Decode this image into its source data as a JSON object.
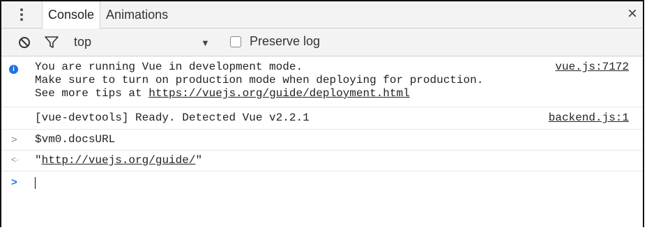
{
  "tabbar": {
    "menu_icon": "kebab-menu-icon",
    "tabs": [
      {
        "label": "Console",
        "active": true
      },
      {
        "label": "Animations",
        "active": false
      }
    ],
    "close_icon": "close-icon",
    "close_glyph": "×"
  },
  "toolbar": {
    "clear_icon": "clear-console-icon",
    "filter_icon": "filter-icon",
    "context_label": "top",
    "dropdown_glyph": "▼",
    "preserve_log_label": "Preserve log",
    "preserve_log_checked": false
  },
  "console": {
    "messages": [
      {
        "type": "info",
        "icon": "info-icon",
        "line1": "You are running Vue in development mode.",
        "line2": "Make sure to turn on production mode when deploying for production.",
        "line3_prefix": "See more tips at ",
        "line3_link": "https://vuejs.org/guide/deployment.html",
        "source": "vue.js:7172"
      },
      {
        "type": "log",
        "text": "[vue-devtools] Ready. Detected Vue v2.2.1",
        "source": "backend.js:1"
      }
    ],
    "input": {
      "prompt_glyph": ">",
      "text": "$vm0.docsURL"
    },
    "result": {
      "prompt_glyph": "<·",
      "quote_open": "\"",
      "link": "http://vuejs.org/guide/",
      "quote_close": "\""
    },
    "prompt": {
      "prompt_glyph": ">"
    }
  },
  "colors": {
    "accent_blue": "#1a73e8",
    "toolbar_bg": "#f3f3f3",
    "border": "#cfcfcf"
  }
}
